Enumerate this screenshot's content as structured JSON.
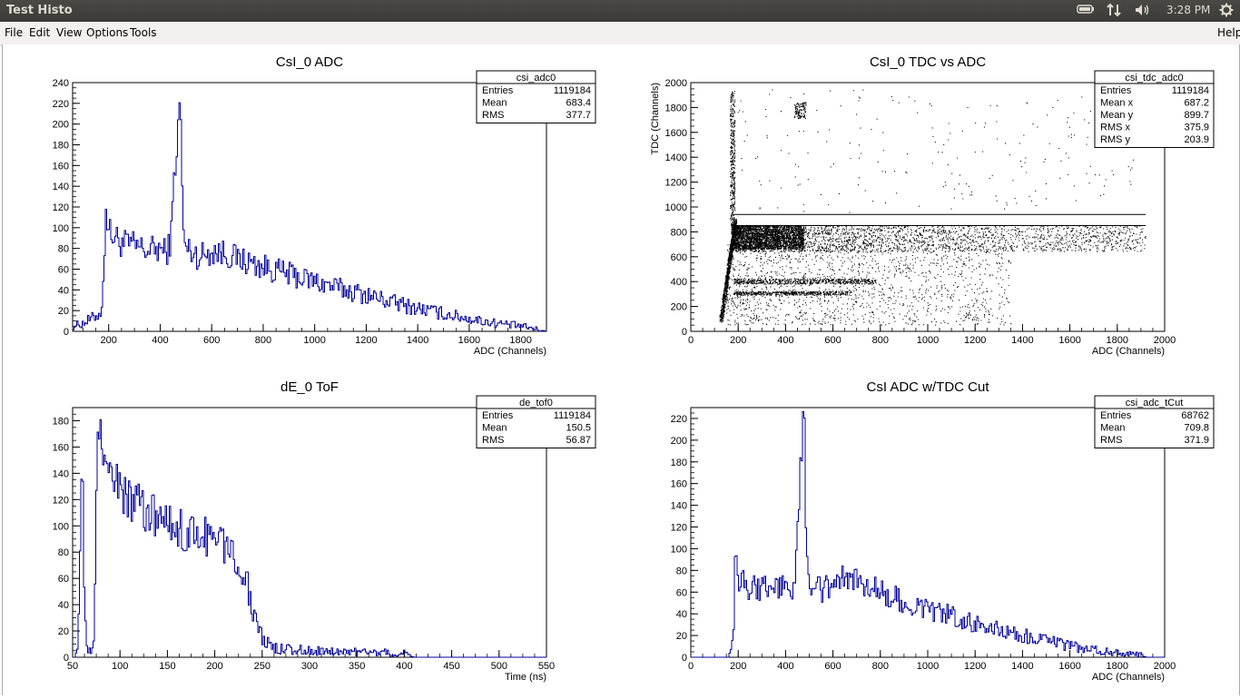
{
  "window": {
    "title": "Test Histo"
  },
  "indicators": {
    "battery": "battery-icon",
    "network": "network-icon",
    "volume": "volume-icon",
    "clock": "3:28 PM",
    "settings": "gear-icon"
  },
  "menu": {
    "file": "File",
    "edit": "Edit",
    "view": "View",
    "options": "Options",
    "tools": "Tools",
    "help": "Help"
  },
  "colors": {
    "histo_line": "#000099",
    "scatter": "#000000",
    "frame": "#000000"
  },
  "chart_data": [
    {
      "type": "line",
      "title": "CsI_0 ADC",
      "xlabel": "ADC (Channels)",
      "ylabel": "",
      "xlim": [
        60,
        1900
      ],
      "ylim": [
        0,
        240
      ],
      "xticks": [
        200,
        400,
        600,
        800,
        1000,
        1200,
        1400,
        1600,
        1800
      ],
      "yticks": [
        0,
        20,
        40,
        60,
        80,
        100,
        120,
        140,
        160,
        180,
        200,
        220,
        240
      ],
      "x": [
        60,
        100,
        150,
        170,
        180,
        185,
        190,
        200,
        250,
        300,
        350,
        400,
        420,
        440,
        450,
        460,
        470,
        475,
        480,
        485,
        490,
        500,
        550,
        600,
        650,
        700,
        800,
        900,
        1000,
        1100,
        1200,
        1300,
        1400,
        1500,
        1600,
        1700,
        1800,
        1860,
        1900
      ],
      "y": [
        5,
        8,
        15,
        20,
        55,
        142,
        110,
        95,
        85,
        82,
        78,
        80,
        75,
        90,
        140,
        180,
        195,
        228,
        190,
        105,
        85,
        80,
        72,
        78,
        75,
        70,
        62,
        55,
        48,
        41,
        35,
        28,
        22,
        17,
        12,
        8,
        5,
        2,
        0
      ],
      "stats": {
        "name": "csi_adc0",
        "rows": [
          [
            "Entries",
            "1119184"
          ],
          [
            "Mean",
            "683.4"
          ],
          [
            "RMS",
            "377.7"
          ]
        ]
      }
    },
    {
      "type": "scatter",
      "title": "CsI_0 TDC vs ADC",
      "xlabel": "ADC (Channels)",
      "ylabel": "TDC (Channels)",
      "xlim": [
        0,
        2000
      ],
      "ylim": [
        0,
        2000
      ],
      "xticks": [
        0,
        200,
        400,
        600,
        800,
        1000,
        1200,
        1400,
        1600,
        1800,
        2000
      ],
      "yticks": [
        0,
        200,
        400,
        600,
        800,
        1000,
        1200,
        1400,
        1600,
        1800,
        2000
      ],
      "band": {
        "x": [
          170,
          1920
        ],
        "y": [
          660,
          850
        ]
      },
      "lines": [
        {
          "x": [
            170,
            1920
          ],
          "y": 850
        },
        {
          "x": [
            170,
            1920
          ],
          "y": 940
        }
      ],
      "cluster": {
        "x": 460,
        "y": 1780
      },
      "stats": {
        "name": "csi_tdc_adc0",
        "rows": [
          [
            "Entries",
            "1119184"
          ],
          [
            "Mean x",
            "687.2"
          ],
          [
            "Mean y",
            "899.7"
          ],
          [
            "RMS x",
            "375.9"
          ],
          [
            "RMS y",
            "203.9"
          ]
        ]
      }
    },
    {
      "type": "line",
      "title": "dE_0 ToF",
      "xlabel": "Time (ns)",
      "ylabel": "",
      "xlim": [
        50,
        550
      ],
      "ylim": [
        0,
        190
      ],
      "xticks": [
        50,
        100,
        150,
        200,
        250,
        300,
        350,
        400,
        450,
        500,
        550
      ],
      "yticks": [
        0,
        20,
        40,
        60,
        80,
        100,
        120,
        140,
        160,
        180
      ],
      "x": [
        50,
        55,
        58,
        60,
        62,
        65,
        70,
        72,
        75,
        77,
        80,
        90,
        100,
        120,
        150,
        175,
        200,
        220,
        230,
        240,
        250,
        260,
        300,
        350,
        400,
        405,
        410,
        550
      ],
      "y": [
        0,
        5,
        110,
        145,
        30,
        5,
        3,
        20,
        150,
        182,
        160,
        140,
        125,
        115,
        100,
        95,
        90,
        80,
        65,
        35,
        15,
        7,
        5,
        4,
        3,
        1,
        0,
        0
      ],
      "stats": {
        "name": "de_tof0",
        "rows": [
          [
            "Entries",
            "1119184"
          ],
          [
            "Mean",
            "150.5"
          ],
          [
            "RMS",
            "56.87"
          ]
        ]
      }
    },
    {
      "type": "line",
      "title": "CsI ADC w/TDC Cut",
      "xlabel": "ADC (Channels)",
      "ylabel": "",
      "xlim": [
        0,
        2000
      ],
      "ylim": [
        0,
        230
      ],
      "xticks": [
        0,
        200,
        400,
        600,
        800,
        1000,
        1200,
        1400,
        1600,
        1800,
        2000
      ],
      "yticks": [
        0,
        20,
        40,
        60,
        80,
        100,
        120,
        140,
        160,
        180,
        200,
        220
      ],
      "x": [
        0,
        150,
        170,
        180,
        185,
        190,
        200,
        250,
        300,
        350,
        400,
        420,
        440,
        450,
        460,
        470,
        475,
        480,
        485,
        490,
        500,
        550,
        600,
        650,
        700,
        800,
        900,
        1000,
        1100,
        1200,
        1300,
        1400,
        1500,
        1600,
        1700,
        1800,
        1900,
        1920,
        2000
      ],
      "y": [
        0,
        0,
        5,
        30,
        100,
        80,
        70,
        65,
        62,
        63,
        65,
        60,
        75,
        120,
        175,
        200,
        225,
        185,
        95,
        72,
        68,
        62,
        68,
        72,
        68,
        60,
        52,
        45,
        38,
        31,
        25,
        20,
        15,
        10,
        7,
        4,
        2,
        0,
        0
      ],
      "stats": {
        "name": "csi_adc_tCut",
        "rows": [
          [
            "Entries",
            "68762"
          ],
          [
            "Mean",
            "709.8"
          ],
          [
            "RMS",
            "371.9"
          ]
        ]
      }
    }
  ]
}
